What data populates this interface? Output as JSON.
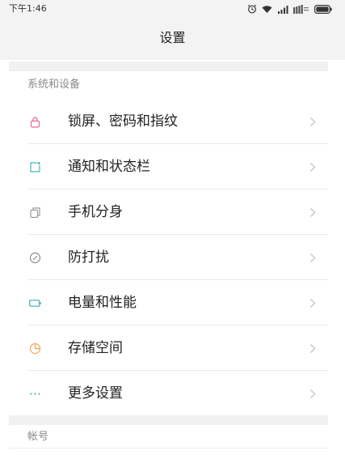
{
  "status_bar": {
    "time": "下午1:46",
    "icons": [
      "alarm-icon",
      "wifi-icon",
      "signal-icon",
      "data-icon",
      "battery-icon"
    ]
  },
  "header": {
    "title": "设置"
  },
  "sections": {
    "system": {
      "title": "系统和设备",
      "items": [
        {
          "label": "锁屏、密码和指纹",
          "icon": "lock-icon",
          "color": "#e56b8b"
        },
        {
          "label": "通知和状态栏",
          "icon": "notification-icon",
          "color": "#4ab3b8"
        },
        {
          "label": "手机分身",
          "icon": "second-space-icon",
          "color": "#9a9a9a"
        },
        {
          "label": "防打扰",
          "icon": "do-not-disturb-icon",
          "color": "#8a8a8a"
        },
        {
          "label": "电量和性能",
          "icon": "battery-icon",
          "color": "#3eb1b5"
        },
        {
          "label": "存储空间",
          "icon": "storage-icon",
          "color": "#f0a359"
        },
        {
          "label": "更多设置",
          "icon": "more-icon",
          "color": "#58b8a5"
        }
      ]
    },
    "account": {
      "title": "帐号"
    }
  },
  "colors": {
    "header_bg": "#f3f3f3",
    "section_text": "#8a8a8a",
    "divider": "#ebebeb",
    "chevron": "#c4c4c4"
  }
}
